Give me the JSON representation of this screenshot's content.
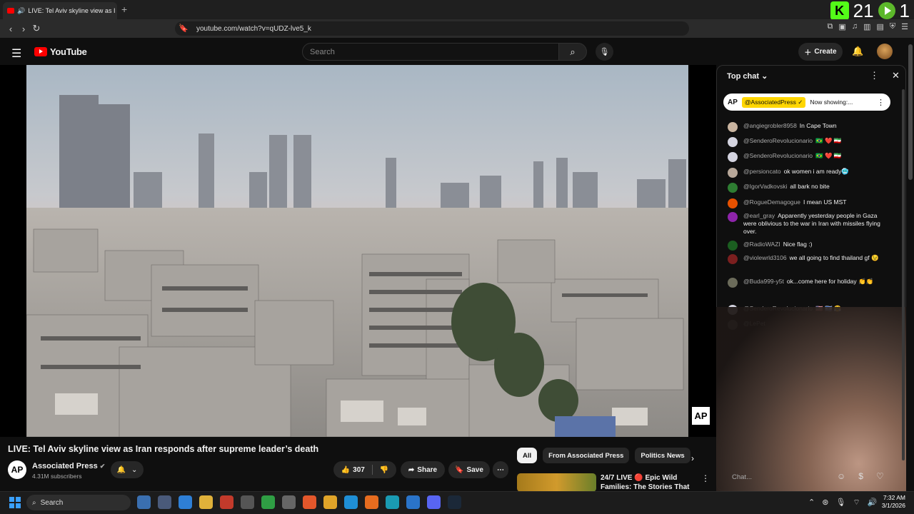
{
  "browser": {
    "tab_title": "LIVE: Tel Aviv skyline view as I",
    "new_tab_symbol": "+",
    "url": "youtube.com/watch?v=qUDZ-lve5_k",
    "overlay_number": "21",
    "overlay_number2": "1",
    "overlay_k": "K"
  },
  "header": {
    "logo_text": "YouTube",
    "search_placeholder": "Search",
    "create_label": "Create"
  },
  "video": {
    "title": "LIVE: Tel Aviv skyline view as Iran responds after supreme leader’s death",
    "watermark": "AP",
    "channel_avatar": "AP",
    "channel_name": "Associated Press",
    "subscribers": "4.31M subscribers",
    "likes": "307",
    "share_label": "Share",
    "save_label": "Save"
  },
  "chips": [
    "All",
    "From Associated Press",
    "Politics News"
  ],
  "recommendation": {
    "title": "24/7 LIVE 🔴 Epic Wild Families: The Stories That ..."
  },
  "chat": {
    "header": "Top chat",
    "pinned_ap": "AP",
    "pinned_name": "@AssociatedPress ✓",
    "pinned_text": "Now showing:...",
    "input_placeholder": "Chat...",
    "messages": [
      {
        "author": "@angiegrobler8958",
        "text": "In Cape Town",
        "color": "#c9b4a0"
      },
      {
        "author": "@SenderoRevolucionario",
        "text": "🇧🇷 ❤️ 🇮🇷",
        "color": "#d4d4e0"
      },
      {
        "author": "@SenderoRevolucionario",
        "text": "🇧🇷 ❤️ 🇮🇷",
        "color": "#d4d4e0"
      },
      {
        "author": "@persioncato",
        "text": "ok women i am ready🥶",
        "color": "#b8a89a"
      },
      {
        "author": "@IgorVadkovski",
        "text": "all bark no bite",
        "color": "#2e7d32"
      },
      {
        "author": "@RogueDemagogue",
        "text": "I mean US MST",
        "color": "#e65100"
      },
      {
        "author": "@earl_gray",
        "text": "Apparently yesterday people in Gaza were oblivious to the war in Iran with missiles flying over.",
        "color": "#8e24aa"
      },
      {
        "author": "@RadioWAZI",
        "text": "Nice flag :)",
        "color": "#1b5e20"
      },
      {
        "author": "@violewrld3106",
        "text": "we all going to find thailand gf 😉",
        "color": "#7b1f1f"
      },
      {
        "author": "@Buda999-y5t",
        "text": "ok...come here for holiday 👏👏",
        "color": "#6b6b5a"
      },
      {
        "author": "@SenderoRevolucionario",
        "text": "🇺🇸 🇮🇱 😤",
        "color": "#d4d4e0"
      },
      {
        "author": "@LePet",
        "text": "",
        "color": "#616161"
      }
    ]
  },
  "taskbar": {
    "search_label": "Search",
    "time": "7:32 AM",
    "date": "3/1/2026"
  }
}
